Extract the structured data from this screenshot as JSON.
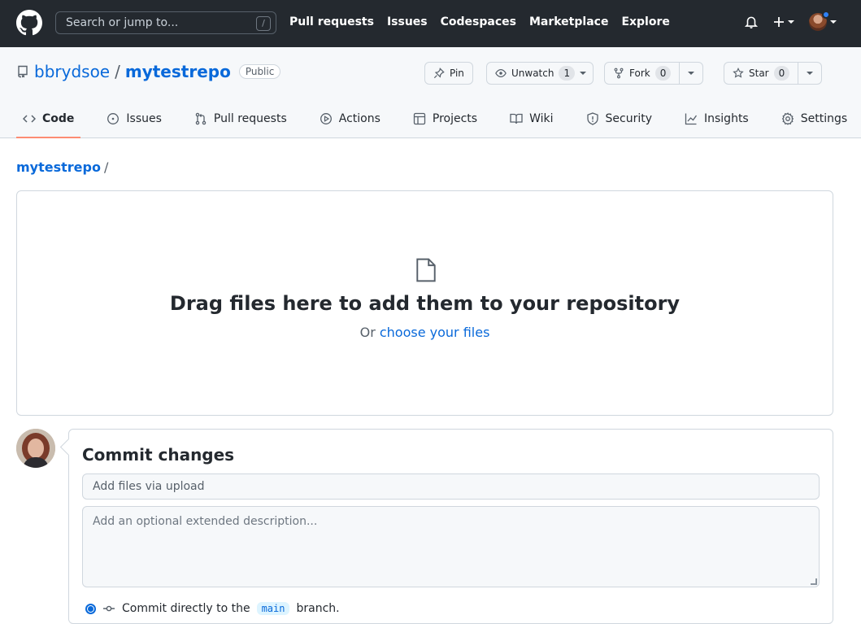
{
  "header": {
    "search_placeholder": "Search or jump to...",
    "search_shortcut": "/",
    "nav": [
      "Pull requests",
      "Issues",
      "Codespaces",
      "Marketplace",
      "Explore"
    ]
  },
  "repo": {
    "owner": "bbrydsoe",
    "separator": "/",
    "name": "mytestrepo",
    "visibility": "Public",
    "pin_label": "Pin",
    "unwatch_label": "Unwatch",
    "watch_count": "1",
    "fork_label": "Fork",
    "fork_count": "0",
    "star_label": "Star",
    "star_count": "0"
  },
  "tabs": [
    {
      "label": "Code",
      "icon": "code-icon",
      "active": true
    },
    {
      "label": "Issues",
      "icon": "issue-icon"
    },
    {
      "label": "Pull requests",
      "icon": "pull-request-icon"
    },
    {
      "label": "Actions",
      "icon": "play-icon"
    },
    {
      "label": "Projects",
      "icon": "table-icon"
    },
    {
      "label": "Wiki",
      "icon": "book-icon"
    },
    {
      "label": "Security",
      "icon": "shield-icon"
    },
    {
      "label": "Insights",
      "icon": "graph-icon"
    },
    {
      "label": "Settings",
      "icon": "gear-icon"
    }
  ],
  "breadcrumb": {
    "repo": "mytestrepo",
    "separator": "/"
  },
  "dropzone": {
    "title": "Drag files here to add them to your repository",
    "prefix": "Or",
    "link": "choose your files"
  },
  "commit": {
    "title": "Commit changes",
    "summary_placeholder": "Add files via upload",
    "description_placeholder": "Add an optional extended description...",
    "branch_prefix": "Commit directly to the",
    "branch": "main",
    "branch_suffix": "branch."
  },
  "colors": {
    "header_bg": "#24292f",
    "link": "#0969da",
    "active_tab_underline": "#fd8c73"
  }
}
